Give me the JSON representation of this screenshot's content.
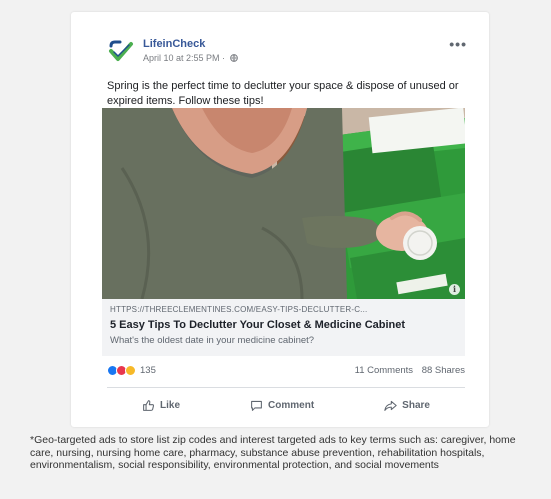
{
  "post": {
    "page_name": "LifeinCheck",
    "timestamp": "April 10 at 2:55 PM ·",
    "privacy_icon": "globe-icon",
    "more_label": "•••",
    "text": "Spring is the perfect time to declutter your space & dispose of unused or expired items. Follow these tips!",
    "brand_colors": {
      "logo_green": "#4caf50",
      "logo_blue": "#1f4e8c",
      "link_blue": "#385898"
    }
  },
  "link_preview": {
    "url": "HTTPS://THREECLEMENTINES.COM/EASY-TIPS-DECLUTTER-C...",
    "title": "5 Easy Tips To Declutter Your Closet & Medicine Cabinet",
    "description": "What's the oldest date in your medicine cabinet?",
    "info_label": "i"
  },
  "engagement": {
    "reactions": [
      "like",
      "love",
      "wow"
    ],
    "reaction_count": "135",
    "comments": "11 Comments",
    "shares": "88 Shares"
  },
  "actions": [
    {
      "label": "Like",
      "icon": "thumbs-up-icon"
    },
    {
      "label": "Comment",
      "icon": "comment-icon"
    },
    {
      "label": "Share",
      "icon": "share-icon"
    }
  ],
  "footnote": "*Geo-targeted ads to store list zip codes and interest targeted ads to key terms such as: caregiver, home care, nursing, nursing home care, pharmacy, substance abuse prevention, rehabilitation hospitals, environmentalism, social responsibility, environmental protection, and social movements"
}
